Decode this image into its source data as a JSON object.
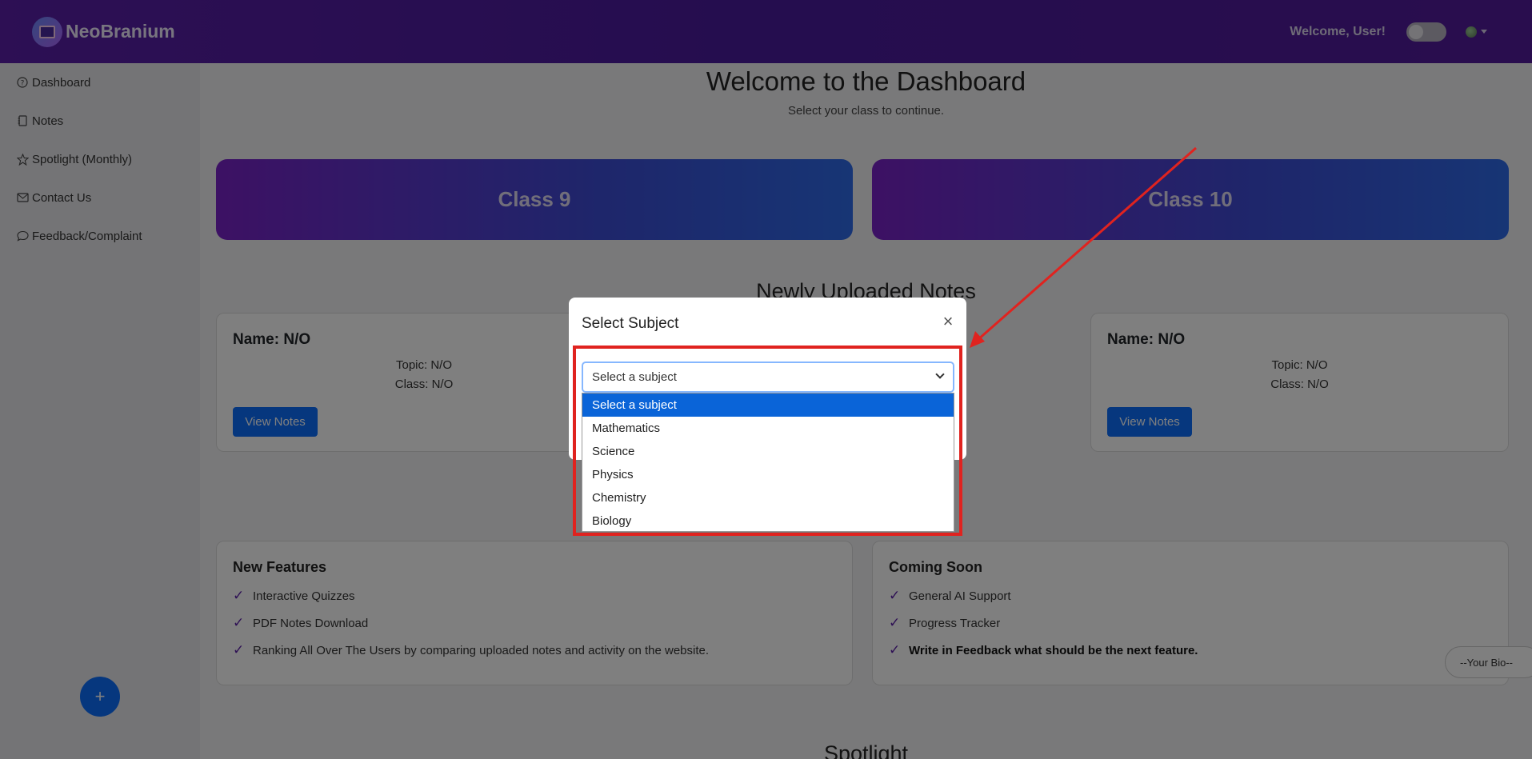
{
  "header": {
    "brand": "NeoBranium",
    "welcome": "Welcome, User!"
  },
  "sidebar": {
    "items": [
      {
        "label": "Dashboard",
        "icon": "question-circle-icon"
      },
      {
        "label": "Notes",
        "icon": "journal-icon"
      },
      {
        "label": "Spotlight (Monthly)",
        "icon": "star-icon"
      },
      {
        "label": "Contact Us",
        "icon": "envelope-icon"
      },
      {
        "label": "Feedback/Complaint",
        "icon": "chat-icon"
      }
    ],
    "fab_label": "+"
  },
  "main": {
    "title": "Welcome to the Dashboard",
    "subtitle": "Select your class to continue.",
    "classes": [
      "Class 9",
      "Class 10"
    ],
    "notes_section_title": "Newly Uploaded Notes",
    "notes": [
      {
        "name": "Name: N/O",
        "topic": "Topic: N/O",
        "class": "Class: N/O",
        "button": "View Notes"
      },
      {
        "name": "Name: N/O",
        "topic": "Topic: N/O",
        "class": "Class: N/O",
        "button": "View Notes"
      }
    ],
    "new_features": {
      "title": "New Features",
      "items": [
        "Interactive Quizzes",
        "PDF Notes Download",
        "Ranking All Over The Users by comparing uploaded notes and activity on the website."
      ]
    },
    "coming_soon": {
      "title": "Coming Soon",
      "items": [
        "General AI Support",
        "Progress Tracker",
        "Write in Feedback what should be the next feature."
      ]
    },
    "spotlight_title": "Spotlight",
    "bio_button": "--Your Bio--"
  },
  "modal": {
    "title": "Select Subject",
    "close": "×",
    "select_value": "Select a subject",
    "options": [
      "Select a subject",
      "Mathematics",
      "Science",
      "Physics",
      "Chemistry",
      "Biology"
    ]
  },
  "colors": {
    "accent": "#0d6efd",
    "header": "#4a1a9e",
    "annotation": "#e0231f"
  }
}
